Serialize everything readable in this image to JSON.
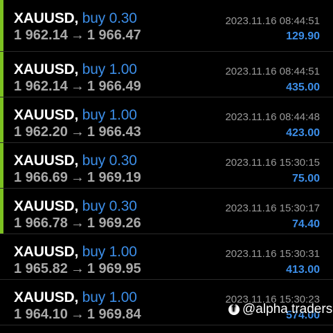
{
  "trades": [
    {
      "symbol": "XAUUSD",
      "side": "buy",
      "volume": "0.30",
      "open_price": "1 962.14",
      "close_price": "1 966.47",
      "time": "2023.11.16 08:44:51",
      "profit": "129.90",
      "marker": "green"
    },
    {
      "symbol": "XAUUSD",
      "side": "buy",
      "volume": "1.00",
      "open_price": "1 962.14",
      "close_price": "1 966.49",
      "time": "2023.11.16 08:44:51",
      "profit": "435.00",
      "marker": "green"
    },
    {
      "symbol": "XAUUSD",
      "side": "buy",
      "volume": "1.00",
      "open_price": "1 962.20",
      "close_price": "1 966.43",
      "time": "2023.11.16 08:44:48",
      "profit": "423.00",
      "marker": "green"
    },
    {
      "symbol": "XAUUSD",
      "side": "buy",
      "volume": "0.30",
      "open_price": "1 966.69",
      "close_price": "1 969.19",
      "time": "2023.11.16 15:30:15",
      "profit": "75.00",
      "marker": "green"
    },
    {
      "symbol": "XAUUSD",
      "side": "buy",
      "volume": "0.30",
      "open_price": "1 966.78",
      "close_price": "1 969.26",
      "time": "2023.11.16 15:30:17",
      "profit": "74.40",
      "marker": "green"
    },
    {
      "symbol": "XAUUSD",
      "side": "buy",
      "volume": "1.00",
      "open_price": "1 965.82",
      "close_price": "1 969.95",
      "time": "2023.11.16 15:30:31",
      "profit": "413.00",
      "marker": "none"
    },
    {
      "symbol": "XAUUSD",
      "side": "buy",
      "volume": "1.00",
      "open_price": "1 964.10",
      "close_price": "1 969.84",
      "time": "2023.11.16 15:30:23",
      "profit": "574.00",
      "marker": "none"
    }
  ],
  "arrow_glyph": "→",
  "watermark": {
    "icon": "facebook-icon",
    "text": "@alpha traders"
  },
  "colors": {
    "background": "#000000",
    "marker_green": "#7cc221",
    "accent_blue": "#3c8ee8",
    "price_gray": "#a9a9a9",
    "time_gray": "#9a9a9a",
    "divider": "#2b2b2b"
  }
}
